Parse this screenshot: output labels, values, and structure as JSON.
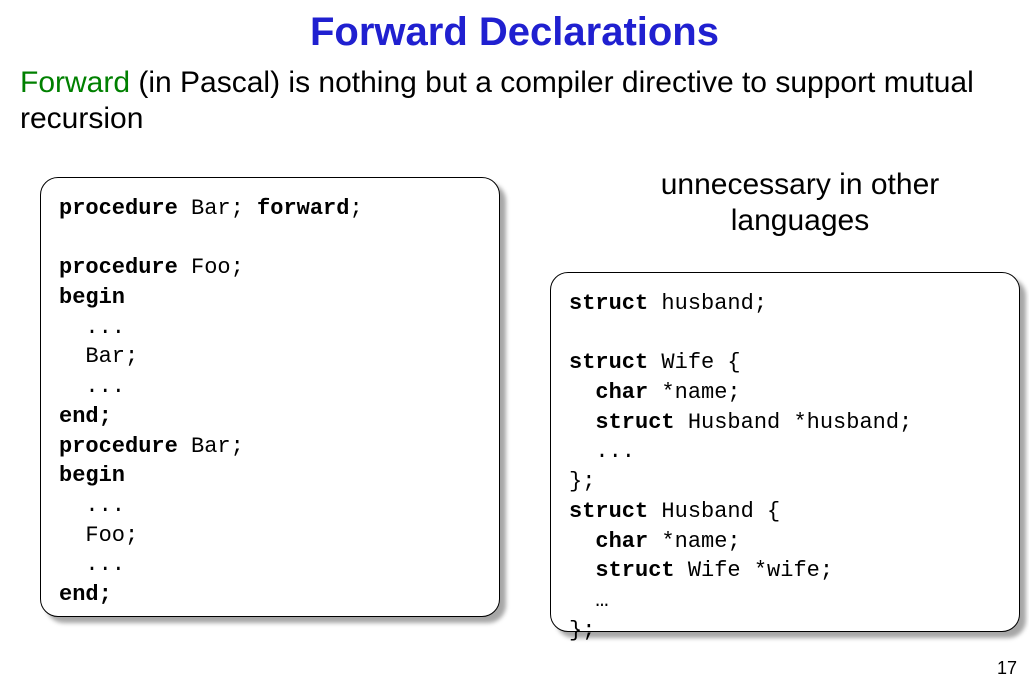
{
  "title": "Forward Declarations",
  "subtitle_forward": "Forward",
  "subtitle_rest": " (in Pascal) is nothing but a compiler directive to support mutual recursion",
  "right_heading": "unnecessary in other languages",
  "page_number": "17",
  "code_left": {
    "l1a": "procedure",
    "l1b": " Bar; ",
    "l1c": "forward",
    "l1d": ";",
    "l2": "",
    "l3a": "procedure",
    "l3b": " Foo;",
    "l4": "begin",
    "l5": "  ...",
    "l6": "  Bar;",
    "l7": "  ...",
    "l8": "end;",
    "l9a": "procedure",
    "l9b": " Bar;",
    "l10": "begin",
    "l11": "  ...",
    "l12": "  Foo;",
    "l13": "  ...",
    "l14": "end;"
  },
  "code_right": {
    "l1a": "struct",
    "l1b": " husband;",
    "l2": "",
    "l3a": "struct",
    "l3b": " Wife {",
    "l4a": "  char",
    "l4b": " *name;",
    "l5a": "  struct",
    "l5b": " Husband *husband;",
    "l6": "  ...",
    "l7": "};",
    "l8a": "struct",
    "l8b": " Husband {",
    "l9a": "  char",
    "l9b": " *name;",
    "l10a": "  struct",
    "l10b": " Wife *wife;",
    "l11": "  …",
    "l12": "};"
  }
}
